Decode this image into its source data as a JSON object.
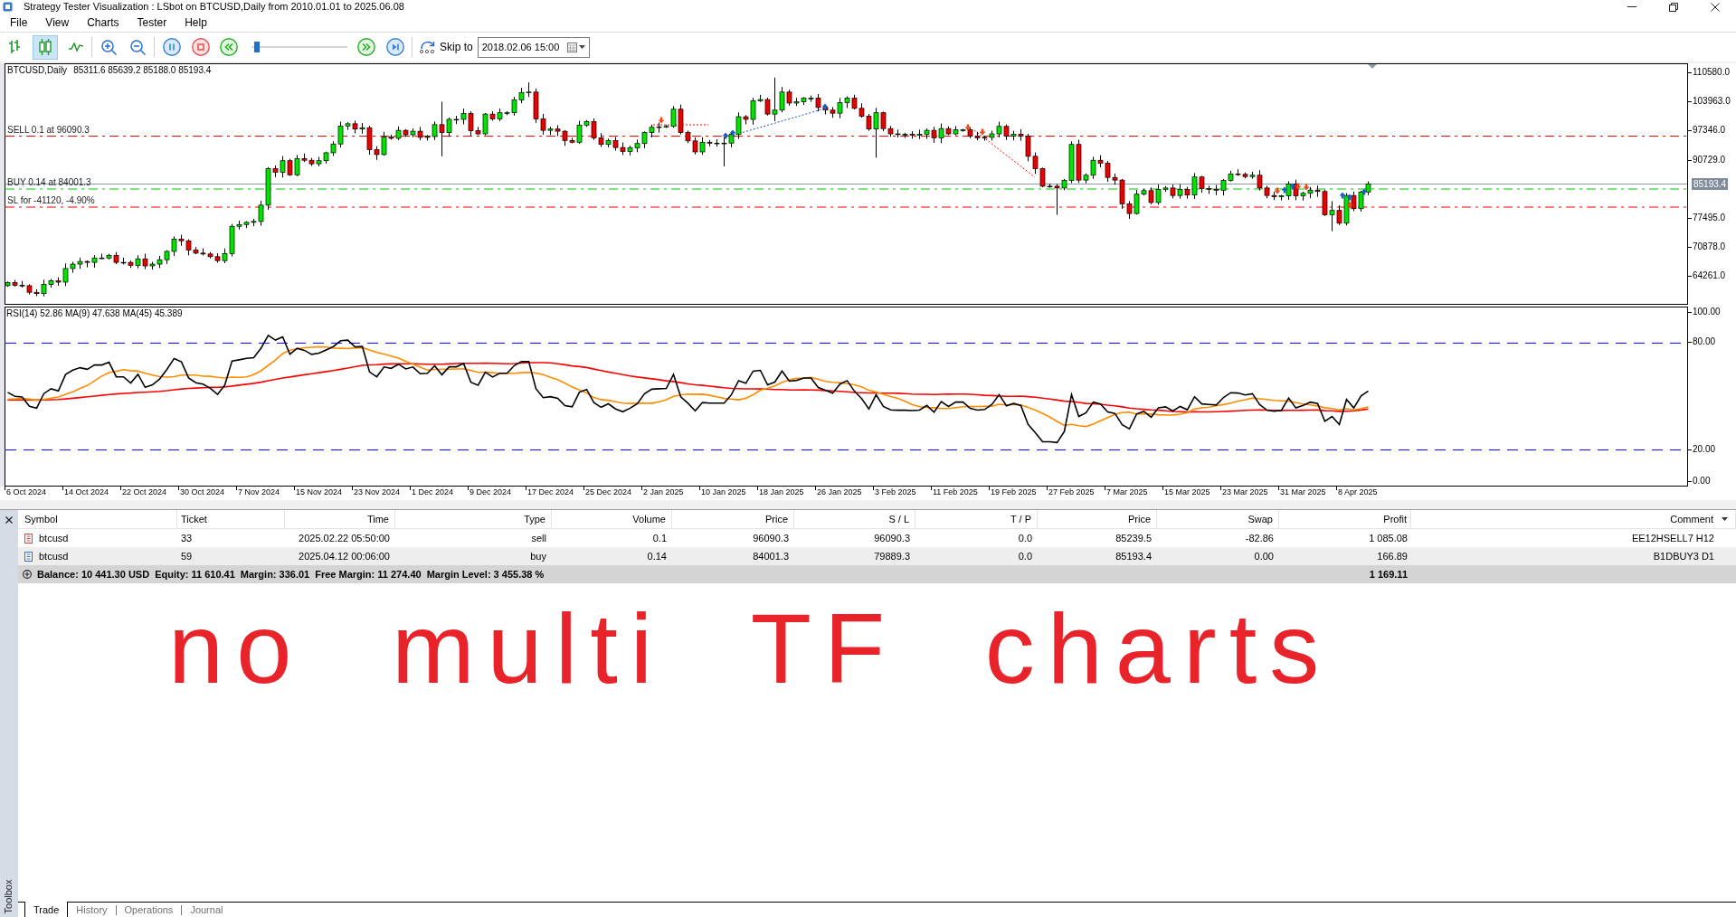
{
  "window": {
    "title": "Strategy Tester Visualization : LSbot on BTCUSD,Daily from 2010.01.01 to 2025.06.08"
  },
  "menu": [
    "File",
    "View",
    "Charts",
    "Tester",
    "Help"
  ],
  "toolbar": {
    "chart_types": [
      {
        "kind": "bars",
        "selected": false
      },
      {
        "kind": "candles",
        "selected": true
      },
      {
        "kind": "line",
        "selected": false
      }
    ],
    "speed": {
      "level": 0.03
    },
    "skip_label": "Skip to",
    "skip_date": "2018.02.06 15:00"
  },
  "price_chart": {
    "symbol": "BTCUSD,Daily",
    "ohlc": "85311.6 85639.2 85188.0 85193.4",
    "levels": [
      {
        "kind": "sell",
        "label": "SELL 0.1 at 96090.3"
      },
      {
        "kind": "buy",
        "label": "BUY 0.14 at 84001.3"
      },
      {
        "kind": "stop_loss",
        "label": "SL for -41120, -4.90%"
      }
    ],
    "price_ticks": [
      "110580.0",
      "103963.0",
      "97346.0",
      "90729.0",
      "77495.0",
      "70878.0",
      "64261.0"
    ],
    "current_price": "85193.4"
  },
  "indicator": {
    "label": "RSI(14) 52.86 MA(9) 47.638 MA(45) 45.389",
    "ticks": [
      "100.00",
      "80.00",
      "20.00",
      "0.00"
    ]
  },
  "date_axis": [
    "6 Oct 2024",
    "14 Oct 2024",
    "22 Oct 2024",
    "30 Oct 2024",
    "7 Nov 2024",
    "15 Nov 2024",
    "23 Nov 2024",
    "1 Dec 2024",
    "9 Dec 2024",
    "17 Dec 2024",
    "25 Dec 2024",
    "2 Jan 2025",
    "10 Jan 2025",
    "18 Jan 2025",
    "26 Jan 2025",
    "3 Feb 2025",
    "11 Feb 2025",
    "19 Feb 2025",
    "27 Feb 2025",
    "7 Mar 2025",
    "15 Mar 2025",
    "23 Mar 2025",
    "31 Mar 2025",
    "8 Apr 2025"
  ],
  "trade_table": {
    "columns": [
      "Symbol",
      "Ticket",
      "Time",
      "Type",
      "Volume",
      "Price",
      "S / L",
      "T / P",
      "Price",
      "Swap",
      "Profit",
      "Comment"
    ],
    "rows": [
      {
        "kind": "sell",
        "cells": [
          "btcusd",
          "33",
          "2025.02.22 05:50:00",
          "sell",
          "0.1",
          "96090.3",
          "96090.3",
          "0.0",
          "85239.5",
          "-82.86",
          "1 085.08",
          "EE12HSELL7 H12"
        ]
      },
      {
        "kind": "buy",
        "cells": [
          "btcusd",
          "59",
          "2025.04.12 00:06:00",
          "buy",
          "0.14",
          "84001.3",
          "79889.3",
          "0.0",
          "85193.4",
          "0.00",
          "166.89",
          "B1DBUY3 D1"
        ]
      }
    ],
    "balance": [
      "Balance: 10 441.30 USD",
      "Equity: 11 610.41",
      "Margin: 336.01",
      "Free Margin: 11 274.40",
      "Margin Level: 3 455.38 %"
    ],
    "total_profit": "1 169.11"
  },
  "toolbox": {
    "label": "Toolbox",
    "tabs": [
      {
        "label": "Trade",
        "selected": true
      },
      {
        "label": "History",
        "selected": false
      },
      {
        "label": "Operations",
        "selected": false
      },
      {
        "label": "Journal",
        "selected": false
      }
    ]
  },
  "annotation": {
    "text": "no multi TF charts"
  }
}
